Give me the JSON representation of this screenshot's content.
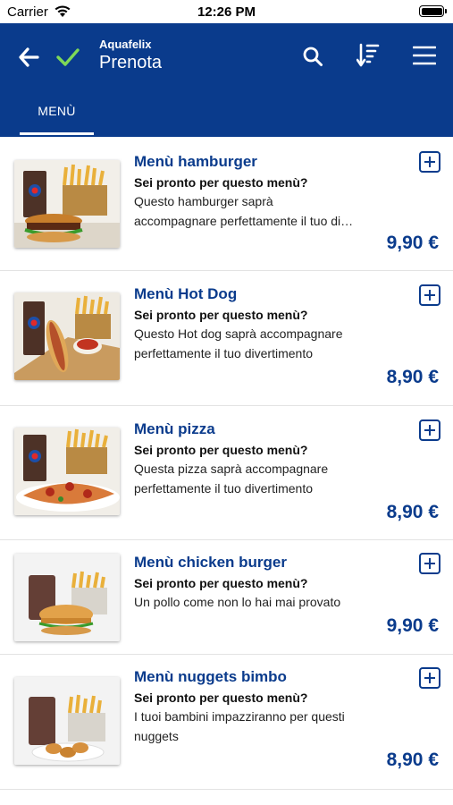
{
  "status_bar": {
    "carrier": "Carrier",
    "time": "12:26 PM"
  },
  "header": {
    "app_name": "Aquafelix",
    "title": "Prenota",
    "icons": [
      "back-arrow-icon",
      "check-icon",
      "search-icon",
      "sort-icon",
      "hamburger-menu-icon"
    ]
  },
  "tabs": [
    {
      "label": "MENÙ",
      "active": true
    }
  ],
  "colors": {
    "primary": "#0a3b8c",
    "check": "#7ed957",
    "divider": "#e3e3e3"
  },
  "items": [
    {
      "title": "Menù hamburger",
      "subtitle": "Sei pronto per questo menù?",
      "desc_line1": "Questo hamburger saprà",
      "desc_line2": "accompagnare perfettamente il tuo divertimento",
      "price": "9,90 €",
      "image": "burger-fries-drink-photo"
    },
    {
      "title": "Menù Hot Dog",
      "subtitle": "Sei pronto per questo menù?",
      "desc_line1": "Questo Hot dog  saprà accompagnare",
      "desc_line2": "perfettamente il tuo divertimento",
      "price": "8,90 €",
      "image": "hotdog-fries-drink-photo"
    },
    {
      "title": "Menù pizza",
      "subtitle": "Sei pronto per questo menù?",
      "desc_line1": "Questa pizza saprà accompagnare",
      "desc_line2": "perfettamente il tuo divertimento",
      "price": "8,90 €",
      "image": "pizza-fries-drink-photo"
    },
    {
      "title": "Menù chicken burger",
      "subtitle": "Sei pronto per questo menù?",
      "desc_line1": "Un pollo come non lo hai mai provato",
      "desc_line2": "",
      "price": "9,90 €",
      "image": "chicken-burger-fries-drink-photo"
    },
    {
      "title": "Menù nuggets bimbo",
      "subtitle": "Sei pronto per questo menù?",
      "desc_line1": "I tuoi bambini impazziranno per questi",
      "desc_line2": "nuggets",
      "price": "8,90 €",
      "image": "nuggets-fries-drink-photo"
    }
  ]
}
